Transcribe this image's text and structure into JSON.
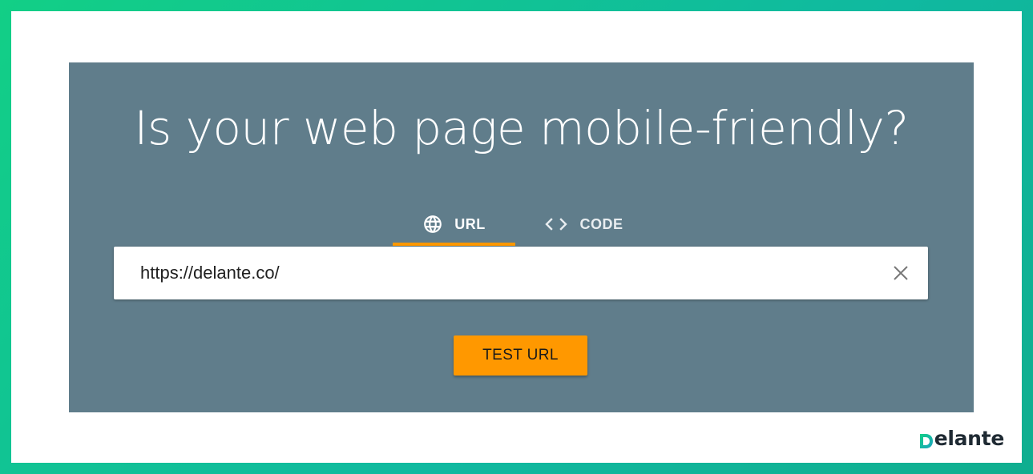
{
  "headline": "Is your web page mobile-friendly?",
  "tabs": [
    {
      "label": "URL",
      "icon": "globe-icon",
      "active": true
    },
    {
      "label": "CODE",
      "icon": "code-brackets-icon",
      "active": false
    }
  ],
  "url_field": {
    "value": "https://delante.co/",
    "clear_icon": "close-icon"
  },
  "test_button": {
    "label": "TEST URL"
  },
  "brand": {
    "logo_text": "elante",
    "logo_mark": "D"
  },
  "colors": {
    "frame_gradient_start": "#12cf86",
    "frame_gradient_end": "#0fae8f",
    "panel": "#607d8b",
    "accent": "#ff9800",
    "input_bg": "#ffffff"
  }
}
